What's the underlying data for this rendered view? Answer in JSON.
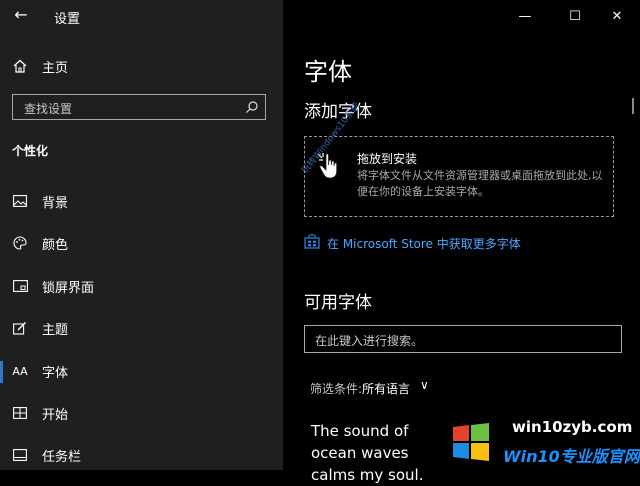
{
  "window": {
    "title": "设置",
    "back_glyph": "←",
    "minimize_glyph": "—",
    "maximize_glyph": "☐",
    "close_glyph": "✕"
  },
  "sidebar": {
    "home_label": "主页",
    "search_placeholder": "查找设置",
    "section": "个性化",
    "items": [
      {
        "label": "背景",
        "icon": "image-icon"
      },
      {
        "label": "颜色",
        "icon": "palette-icon"
      },
      {
        "label": "锁屏界面",
        "icon": "lock-screen-icon"
      },
      {
        "label": "主题",
        "icon": "theme-brush-icon"
      },
      {
        "label": "字体",
        "icon": "font-icon",
        "active": true
      },
      {
        "label": "开始",
        "icon": "start-icon"
      },
      {
        "label": "任务栏",
        "icon": "taskbar-icon"
      }
    ],
    "font_icon_text": "AA"
  },
  "main": {
    "page_title": "字体",
    "add_fonts_heading": "添加字体",
    "drop_zone": {
      "title": "拖放到安装",
      "description": "将字体文件从文件资源管理器或桌面拖放到此处,以便在你的设备上安装字体。"
    },
    "store_link": "在 Microsoft Store 中获取更多字体",
    "available_heading": "可用字体",
    "font_search_placeholder": "在此键入进行搜索。",
    "filter": {
      "label": "筛选条件:",
      "value": "所有语言",
      "chevron": "∨"
    },
    "sample_text": "The sound of ocean waves calms my soul."
  },
  "watermark": {
    "diagonal": "玩转Windows10系统",
    "brand": "win10zyb.com",
    "brand_cn": "Win10专业版官网"
  },
  "colors": {
    "accent": "#2b78d2",
    "link": "#4da6ff",
    "sidebar_bg": "#1f1f1f",
    "main_bg": "#000000"
  }
}
